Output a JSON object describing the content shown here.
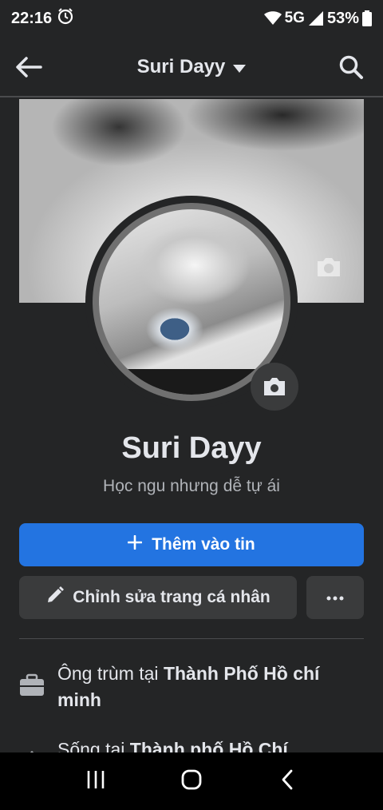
{
  "status_bar": {
    "time": "22:16",
    "network": "5G",
    "battery": "53%"
  },
  "nav": {
    "title": "Suri Dayy"
  },
  "profile": {
    "name": "Suri Dayy",
    "bio": "Học ngu nhưng dễ tự ái"
  },
  "actions": {
    "add_story_label": "Thêm vào tin",
    "edit_profile_label": "Chỉnh sửa trang cá nhân"
  },
  "details": [
    {
      "prefix": "Ông trùm tại ",
      "value": "Thành Phố Hồ chí minh",
      "icon": "briefcase-icon"
    },
    {
      "prefix": "Sống tại ",
      "value": "Thành phố Hồ Chí",
      "icon": "home-icon"
    }
  ],
  "colors": {
    "background": "#242526",
    "primary_button": "#2374e1",
    "secondary_button": "#3a3b3c",
    "text_primary": "#e4e6eb",
    "text_secondary": "#b0b3b8"
  }
}
